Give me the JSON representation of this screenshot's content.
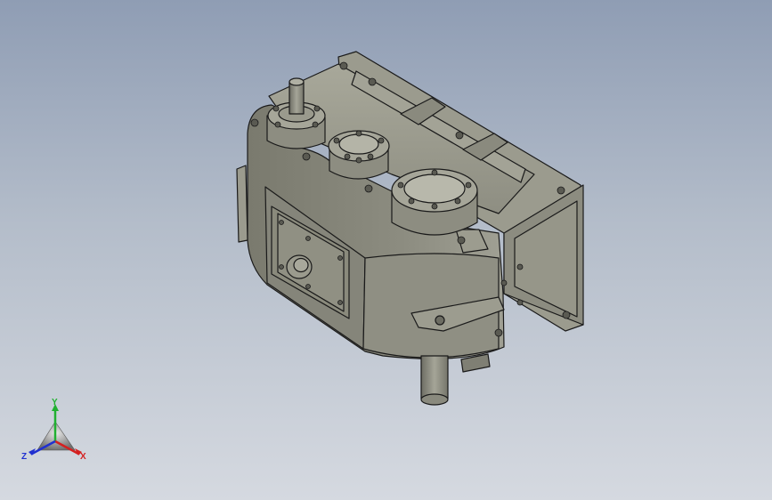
{
  "viewport": {
    "background_top": "#8f9db4",
    "background_bottom": "#d5d9e0",
    "model_color": "#8a8a7e",
    "edge_color": "#1a1a1a"
  },
  "triad": {
    "x_label": "X",
    "y_label": "Y",
    "z_label": "Z",
    "x_color": "#d42020",
    "y_color": "#20b030",
    "z_color": "#2030d0"
  }
}
